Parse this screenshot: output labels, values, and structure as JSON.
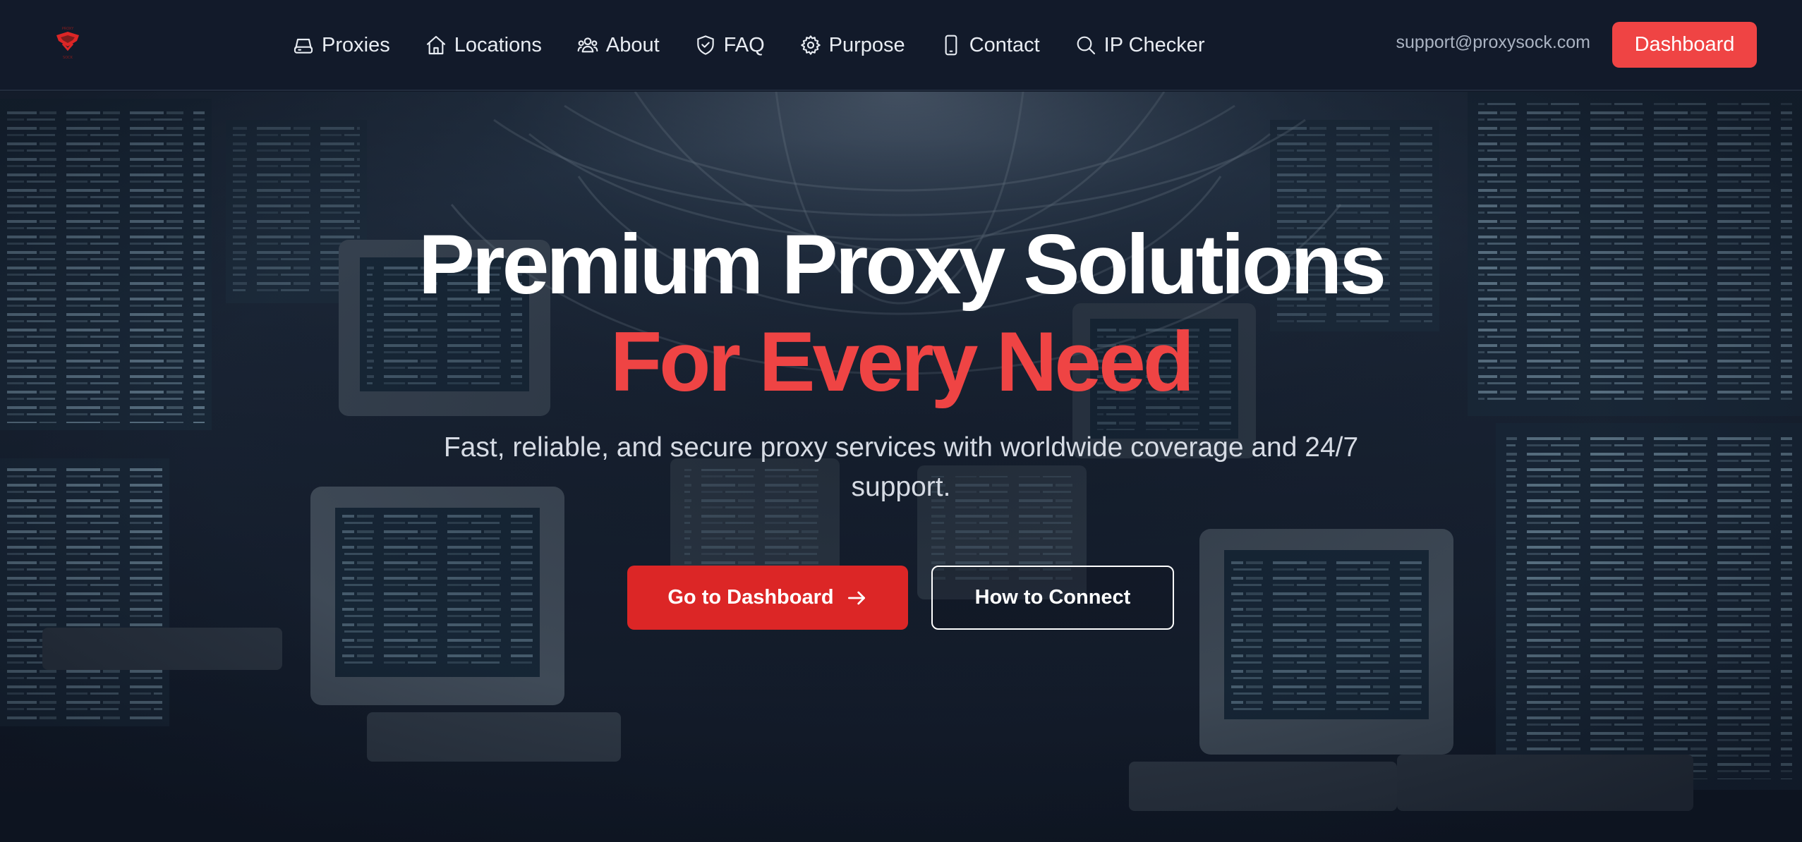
{
  "brand": {
    "logo_icon": "proxy-shield-logo",
    "accent_color": "#ef4444"
  },
  "nav": {
    "items": [
      {
        "label": "Proxies",
        "icon": "server-icon"
      },
      {
        "label": "Locations",
        "icon": "home-icon"
      },
      {
        "label": "About",
        "icon": "users-icon"
      },
      {
        "label": "FAQ",
        "icon": "shield-icon"
      },
      {
        "label": "Purpose",
        "icon": "gear-icon"
      },
      {
        "label": "Contact",
        "icon": "phone-icon"
      },
      {
        "label": "IP Checker",
        "icon": "search-icon"
      }
    ],
    "email": "support@proxysock.com",
    "dashboard_label": "Dashboard"
  },
  "hero": {
    "title_line1": "Premium Proxy Solutions",
    "title_line2": "For Every Need",
    "subtitle": "Fast, reliable, and secure proxy services with worldwide coverage and 24/7 support.",
    "primary_cta": "Go to Dashboard",
    "secondary_cta": "How to Connect"
  }
}
